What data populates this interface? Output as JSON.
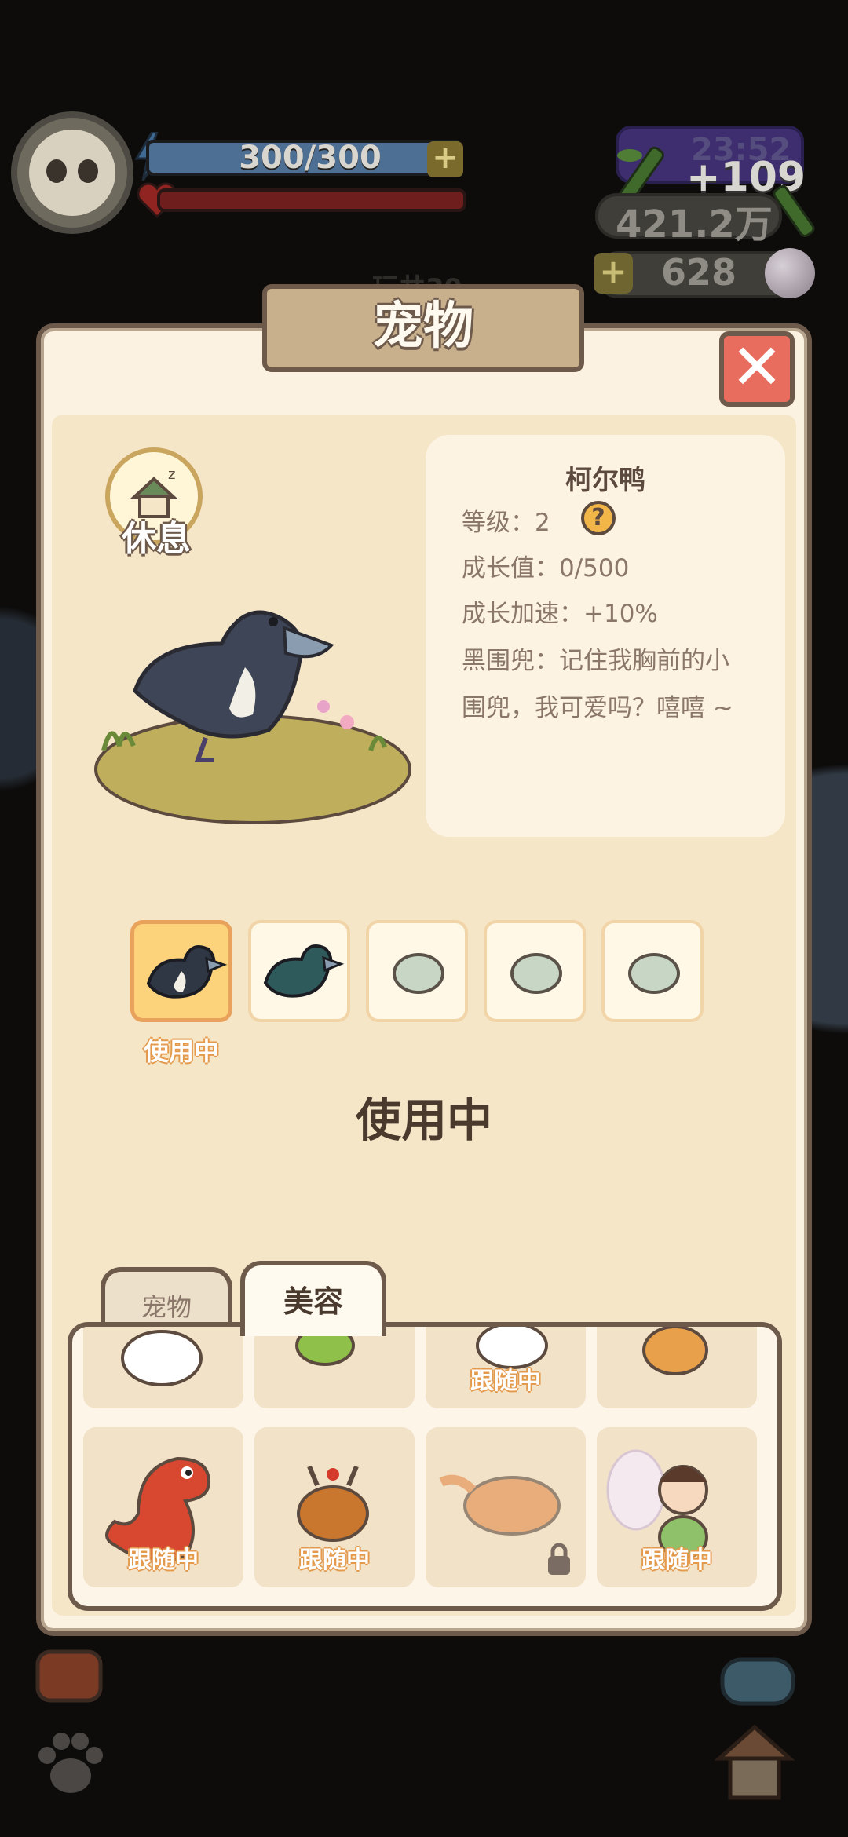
{
  "hud": {
    "energy": "300/300",
    "energy_plus": "+",
    "timer": "23:52",
    "bonus": "+109",
    "coins": "421.2万",
    "gem_plus": "+",
    "gems": "628",
    "ghost_title": "玩井39"
  },
  "dialog": {
    "title": "宠物",
    "close": "✕",
    "rest_label": "休息",
    "pet": {
      "name": "柯尔鸭",
      "level": "等级：2",
      "growth": "成长值：0/500",
      "speedup": "成长加速：+10%",
      "desc_line1": "黑围兜：记住我胸前的小",
      "desc_line2": "围兜，我可爱吗？嘻嘻 ~",
      "help": "?"
    },
    "skins": {
      "selected_badge": "使用中",
      "status_text": "使用中",
      "slots": [
        "black-duck",
        "teal-duck",
        "egg",
        "egg",
        "egg"
      ]
    },
    "tabs": {
      "pet": "宠物",
      "beauty": "美容"
    },
    "grid": {
      "follow_label": "跟随中",
      "row1": [
        "white-rabbit",
        "green-bird",
        "white-mouse",
        "shiba-dog"
      ],
      "row2": [
        "red-dinosaur",
        "deer",
        "tiger",
        "fairy"
      ]
    }
  },
  "colors": {
    "dialog_bg": "#fbf2e2",
    "panel_bg": "#f6e6c8",
    "border": "#6e5a4b",
    "accent_orange": "#e49a4c",
    "close_red": "#e86d5e"
  }
}
